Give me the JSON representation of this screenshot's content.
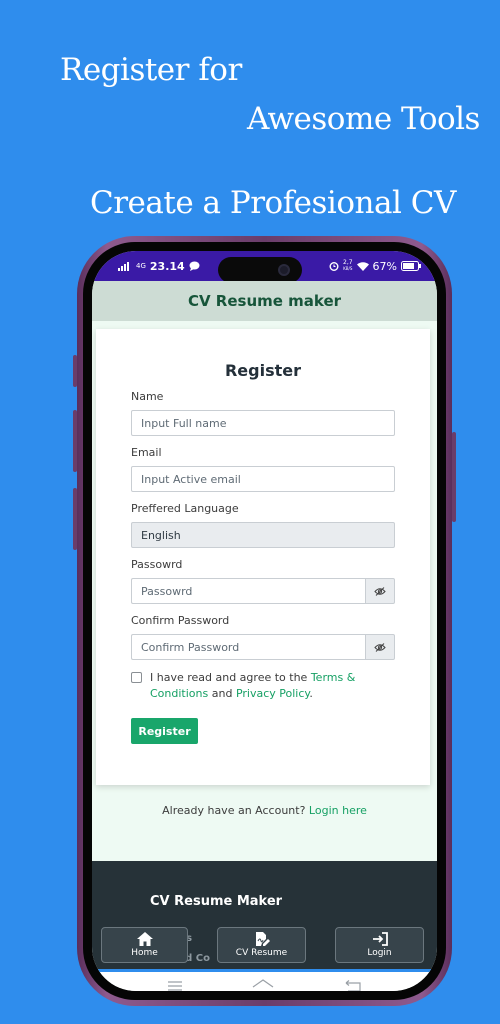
{
  "promo": {
    "line1": "Register for",
    "line2": "Awesome Tools",
    "line3": "Create a Profesional CV"
  },
  "status_bar": {
    "network": "4G",
    "time": "23.14",
    "speed_value": "2,7",
    "speed_unit": "KB/S",
    "battery": "67%"
  },
  "app_bar": {
    "title": "CV Resume maker"
  },
  "form": {
    "title": "Register",
    "name_label": "Name",
    "name_placeholder": "Input Full name",
    "email_label": "Email",
    "email_placeholder": "Input Active email",
    "language_label": "Preffered Language",
    "language_value": "English",
    "password_label": "Passowrd",
    "password_placeholder": "Passowrd",
    "confirm_label": "Confirm Password",
    "confirm_placeholder": "Confirm Password",
    "agree_prefix": "I have read and agree to the",
    "terms_link": "Terms & Conditions",
    "agree_and": "and",
    "privacy_link": "Privacy Policy",
    "agree_suffix": ".",
    "submit_label": "Register"
  },
  "login_prompt": {
    "text": "Already have an Account?",
    "link": "Login here"
  },
  "footer": {
    "title": "CV Resume Maker",
    "partial_1": "Us",
    "partial_2": "nd Co"
  },
  "bottom_nav": [
    {
      "label": "Home",
      "icon": "home-icon"
    },
    {
      "label": "CV Resume",
      "icon": "edit-document-icon"
    },
    {
      "label": "Login",
      "icon": "login-icon"
    }
  ],
  "colors": {
    "background": "#2f8ded",
    "status_bar": "#3a1aa6",
    "accent": "#19a66b",
    "footer": "#263238"
  }
}
